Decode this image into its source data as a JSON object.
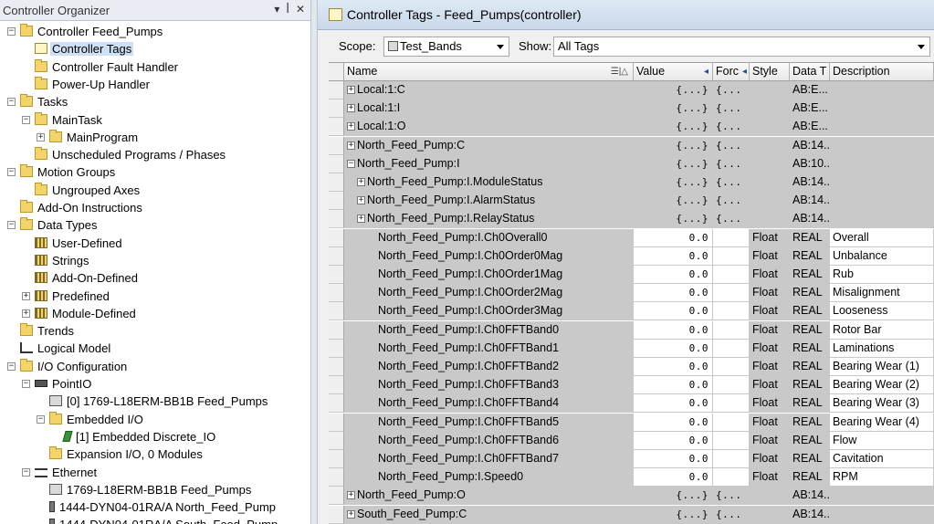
{
  "organizer": {
    "title": "Controller Organizer",
    "pin_glyph": "▾",
    "pushpin_glyph": "ꟾ",
    "close_glyph": "✕",
    "tree": [
      {
        "label": "Controller Feed_Pumps",
        "level": 0,
        "icon": "folder-icon",
        "expander": "−"
      },
      {
        "label": "Controller Tags",
        "level": 1,
        "icon": "tag-icon",
        "selected": true
      },
      {
        "label": "Controller Fault Handler",
        "level": 1,
        "icon": "folder-icon"
      },
      {
        "label": "Power-Up Handler",
        "level": 1,
        "icon": "folder-icon"
      },
      {
        "label": "Tasks",
        "level": 0,
        "icon": "folder-icon",
        "expander": "−"
      },
      {
        "label": "MainTask",
        "level": 1,
        "icon": "task-icon",
        "expander": "−"
      },
      {
        "label": "MainProgram",
        "level": 2,
        "icon": "program-icon",
        "expander": "+"
      },
      {
        "label": "Unscheduled Programs / Phases",
        "level": 1,
        "icon": "folder-icon"
      },
      {
        "label": "Motion Groups",
        "level": 0,
        "icon": "folder-icon",
        "expander": "−"
      },
      {
        "label": "Ungrouped Axes",
        "level": 1,
        "icon": "folder-icon"
      },
      {
        "label": "Add-On Instructions",
        "level": 0,
        "icon": "folder-icon"
      },
      {
        "label": "Data Types",
        "level": 0,
        "icon": "folder-icon",
        "expander": "−"
      },
      {
        "label": "User-Defined",
        "level": 1,
        "icon": "datatype-icon"
      },
      {
        "label": "Strings",
        "level": 1,
        "icon": "datatype-icon"
      },
      {
        "label": "Add-On-Defined",
        "level": 1,
        "icon": "datatype-icon"
      },
      {
        "label": "Predefined",
        "level": 1,
        "icon": "datatype-icon",
        "expander": "+"
      },
      {
        "label": "Module-Defined",
        "level": 1,
        "icon": "datatype-icon",
        "expander": "+"
      },
      {
        "label": "Trends",
        "level": 0,
        "icon": "folder-icon"
      },
      {
        "label": "Logical Model",
        "level": 0,
        "icon": "logical-model-icon"
      },
      {
        "label": "I/O Configuration",
        "level": 0,
        "icon": "folder-icon",
        "expander": "−"
      },
      {
        "label": "PointIO",
        "level": 1,
        "icon": "backplane-icon",
        "expander": "−"
      },
      {
        "label": "[0] 1769-L18ERM-BB1B Feed_Pumps",
        "level": 2,
        "icon": "controller-icon"
      },
      {
        "label": "Embedded I/O",
        "level": 2,
        "icon": "folder-icon",
        "expander": "−"
      },
      {
        "label": "[1] Embedded Discrete_IO",
        "level": 3,
        "icon": "io-module-icon"
      },
      {
        "label": "Expansion I/O, 0 Modules",
        "level": 2,
        "icon": "folder-icon"
      },
      {
        "label": "Ethernet",
        "level": 1,
        "icon": "ethernet-icon",
        "expander": "−"
      },
      {
        "label": "1769-L18ERM-BB1B Feed_Pumps",
        "level": 2,
        "icon": "controller-icon"
      },
      {
        "label": "1444-DYN04-01RA/A North_Feed_Pump",
        "level": 2,
        "icon": "device-icon"
      },
      {
        "label": "1444-DYN04-01RA/A South_Feed_Pump",
        "level": 2,
        "icon": "device-icon"
      }
    ]
  },
  "tags_window": {
    "title": "Controller Tags - Feed_Pumps(controller)",
    "scope_label": "Scope:",
    "scope_value": "Test_Bands",
    "show_label": "Show:",
    "show_value": "All Tags",
    "columns": {
      "name": "Name",
      "value": "Value",
      "force": "Forc",
      "style": "Style",
      "datatype": "Data T",
      "description": "Description"
    },
    "rows": [
      {
        "name": "Local:1:C",
        "value": "{...}",
        "force": "{...",
        "style": "",
        "datatype": "AB:E...",
        "description": "",
        "indent": 0,
        "expander": "+",
        "shade": "gray"
      },
      {
        "name": "Local:1:I",
        "value": "{...}",
        "force": "{...",
        "style": "",
        "datatype": "AB:E...",
        "description": "",
        "indent": 0,
        "expander": "+",
        "shade": "gray"
      },
      {
        "name": "Local:1:O",
        "value": "{...}",
        "force": "{...",
        "style": "",
        "datatype": "AB:E...",
        "description": "",
        "indent": 0,
        "expander": "+",
        "shade": "gray"
      },
      {
        "name": "North_Feed_Pump:C",
        "value": "{...}",
        "force": "{...",
        "style": "",
        "datatype": "AB:14...",
        "description": "",
        "indent": 0,
        "expander": "+",
        "shade": "gray"
      },
      {
        "name": "North_Feed_Pump:I",
        "value": "{...}",
        "force": "{...",
        "style": "",
        "datatype": "AB:10...",
        "description": "",
        "indent": 0,
        "expander": "−",
        "shade": "gray"
      },
      {
        "name": "North_Feed_Pump:I.ModuleStatus",
        "value": "{...}",
        "force": "{...",
        "style": "",
        "datatype": "AB:14...",
        "description": "",
        "indent": 1,
        "expander": "+",
        "shade": "gray"
      },
      {
        "name": "North_Feed_Pump:I.AlarmStatus",
        "value": "{...}",
        "force": "{...",
        "style": "",
        "datatype": "AB:14...",
        "description": "",
        "indent": 1,
        "expander": "+",
        "shade": "gray"
      },
      {
        "name": "North_Feed_Pump:I.RelayStatus",
        "value": "{...}",
        "force": "{...",
        "style": "",
        "datatype": "AB:14...",
        "description": "",
        "indent": 1,
        "expander": "+",
        "shade": "gray"
      },
      {
        "name": "North_Feed_Pump:I.Ch0Overall0",
        "value": "0.0",
        "force": "",
        "style": "Float",
        "datatype": "REAL",
        "description": "Overall",
        "indent": 1,
        "shade": "white"
      },
      {
        "name": "North_Feed_Pump:I.Ch0Order0Mag",
        "value": "0.0",
        "force": "",
        "style": "Float",
        "datatype": "REAL",
        "description": "Unbalance",
        "indent": 1,
        "shade": "white"
      },
      {
        "name": "North_Feed_Pump:I.Ch0Order1Mag",
        "value": "0.0",
        "force": "",
        "style": "Float",
        "datatype": "REAL",
        "description": "Rub",
        "indent": 1,
        "shade": "white"
      },
      {
        "name": "North_Feed_Pump:I.Ch0Order2Mag",
        "value": "0.0",
        "force": "",
        "style": "Float",
        "datatype": "REAL",
        "description": "Misalignment",
        "indent": 1,
        "shade": "white"
      },
      {
        "name": "North_Feed_Pump:I.Ch0Order3Mag",
        "value": "0.0",
        "force": "",
        "style": "Float",
        "datatype": "REAL",
        "description": "Looseness",
        "indent": 1,
        "shade": "white"
      },
      {
        "name": "North_Feed_Pump:I.Ch0FFTBand0",
        "value": "0.0",
        "force": "",
        "style": "Float",
        "datatype": "REAL",
        "description": "Rotor Bar",
        "indent": 1,
        "shade": "white"
      },
      {
        "name": "North_Feed_Pump:I.Ch0FFTBand1",
        "value": "0.0",
        "force": "",
        "style": "Float",
        "datatype": "REAL",
        "description": "Laminations",
        "indent": 1,
        "shade": "white"
      },
      {
        "name": "North_Feed_Pump:I.Ch0FFTBand2",
        "value": "0.0",
        "force": "",
        "style": "Float",
        "datatype": "REAL",
        "description": "Bearing Wear (1)",
        "indent": 1,
        "shade": "white"
      },
      {
        "name": "North_Feed_Pump:I.Ch0FFTBand3",
        "value": "0.0",
        "force": "",
        "style": "Float",
        "datatype": "REAL",
        "description": "Bearing Wear (2)",
        "indent": 1,
        "shade": "white"
      },
      {
        "name": "North_Feed_Pump:I.Ch0FFTBand4",
        "value": "0.0",
        "force": "",
        "style": "Float",
        "datatype": "REAL",
        "description": "Bearing Wear (3)",
        "indent": 1,
        "shade": "white"
      },
      {
        "name": "North_Feed_Pump:I.Ch0FFTBand5",
        "value": "0.0",
        "force": "",
        "style": "Float",
        "datatype": "REAL",
        "description": "Bearing Wear (4)",
        "indent": 1,
        "shade": "white"
      },
      {
        "name": "North_Feed_Pump:I.Ch0FFTBand6",
        "value": "0.0",
        "force": "",
        "style": "Float",
        "datatype": "REAL",
        "description": "Flow",
        "indent": 1,
        "shade": "white"
      },
      {
        "name": "North_Feed_Pump:I.Ch0FFTBand7",
        "value": "0.0",
        "force": "",
        "style": "Float",
        "datatype": "REAL",
        "description": "Cavitation",
        "indent": 1,
        "shade": "white"
      },
      {
        "name": "North_Feed_Pump:I.Speed0",
        "value": "0.0",
        "force": "",
        "style": "Float",
        "datatype": "REAL",
        "description": "RPM",
        "indent": 1,
        "shade": "white"
      },
      {
        "name": "North_Feed_Pump:O",
        "value": "{...}",
        "force": "{...",
        "style": "",
        "datatype": "AB:14...",
        "description": "",
        "indent": 0,
        "expander": "+",
        "shade": "gray"
      },
      {
        "name": "South_Feed_Pump:C",
        "value": "{...}",
        "force": "{...",
        "style": "",
        "datatype": "AB:14...",
        "description": "",
        "indent": 0,
        "expander": "+",
        "shade": "gray"
      }
    ]
  },
  "colors": {
    "row_gray": "#c9c9c9",
    "selection": "#cde0f5",
    "folder": "#f2d46b"
  }
}
